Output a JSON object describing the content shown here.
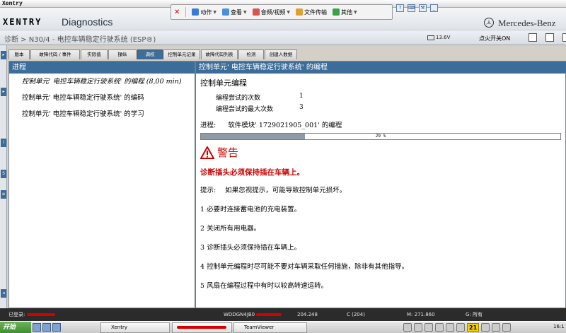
{
  "window": {
    "title": "Xentry"
  },
  "header": {
    "brand": "XENTRY",
    "app_title": "Diagnostics",
    "vendor": "Mercedes-Benz"
  },
  "remote_toolbar": {
    "close_label": "✕",
    "items": [
      {
        "label": "动作",
        "icon": "action-icon",
        "color": "#3a7bd5"
      },
      {
        "label": "查看",
        "icon": "view-icon",
        "color": "#4a90d9"
      },
      {
        "label": "音频/视频",
        "icon": "audio-video-icon",
        "color": "#d9534f"
      },
      {
        "label": "文件传输",
        "icon": "file-transfer-icon",
        "color": "#e0a030"
      },
      {
        "label": "其他",
        "icon": "more-icon",
        "color": "#3aa14a"
      }
    ]
  },
  "pathbar": {
    "breadcrumb": "诊断 > N30/4 - 电控车辆稳定行驶系统 (ESP®)",
    "battery": "13.6V",
    "ignition": "点火开关ON"
  },
  "tabs": [
    {
      "label": "版本",
      "active": false
    },
    {
      "label": "故障代码 / 事件",
      "active": false
    },
    {
      "label": "实际值",
      "active": false
    },
    {
      "label": "操纵",
      "active": false
    },
    {
      "label": "调校",
      "active": true
    },
    {
      "label": "控制单元记录",
      "active": false
    },
    {
      "label": "故障代码列表",
      "active": false
    },
    {
      "label": "检测",
      "active": false
    },
    {
      "label": "创建人数据",
      "active": false
    }
  ],
  "left_panel": {
    "heading": "进程",
    "steps": [
      {
        "label": "控制单元' 电控车辆稳定行驶系统' 的编程 (8,00 min)",
        "current": true
      },
      {
        "label": "控制单元' 电控车辆稳定行驶系统' 的编码",
        "current": false
      },
      {
        "label": "控制单元' 电控车辆稳定行驶系统' 的学习",
        "current": false
      }
    ]
  },
  "right_panel": {
    "heading": "控制单元' 电控车辆稳定行驶系统' 的编程",
    "section_title": "控制单元编程",
    "attempts_label": "编程尝试的次数",
    "attempts_value": "1",
    "max_attempts_label": "编程尝试的最大次数",
    "max_attempts_value": "3",
    "progress_prefix": "进程:",
    "progress_text": "软件模块' 1729021905_001' 的编程",
    "progress_percent": 29,
    "progress_label": "29 %",
    "warning_title": "警告",
    "warning_main": "诊断插头必须保持插在车辆上。",
    "hint_label": "提示:",
    "hint_text": "如果忽视提示，可能导致控制单元损坏。",
    "items": [
      "1 必要时连接蓄电池的充电装置。",
      "2 关闭所有用电器。",
      "3 诊断插头必须保持插在车辆上。",
      "4 控制单元编程时尽可能不要对车辆采取任何措施，除非有其他指导。",
      "5 风扇在编程过程中有时以较高转速运转。"
    ],
    "warning_color": "#cc0000"
  },
  "statusbar": {
    "logged_in": "已登录:",
    "vin_prefix": "WDDGN4JB0",
    "version": "204.248",
    "model": "C (204)",
    "mileage": "M: 271.860",
    "scope": "G: 所有"
  },
  "taskbar": {
    "start_label": "开始",
    "tasks": [
      {
        "label": "Xentry",
        "icon": "xentry-icon"
      },
      {
        "label": "TeamViewer",
        "icon": "teamviewer-icon"
      }
    ],
    "tray_badge": "21",
    "clock": "16:1"
  }
}
